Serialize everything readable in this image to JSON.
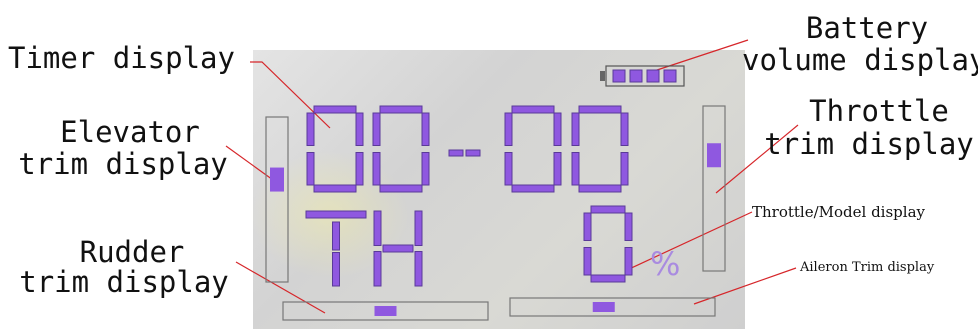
{
  "display": {
    "timer_text": "00-00",
    "mode_text": "TH",
    "throttle_value": "0",
    "percent_sign": "%",
    "elevator_trim": 0.35,
    "throttle_trim": 0.25,
    "rudder_trim": 0.5,
    "aileron_trim": 0.45,
    "battery_bars": 4,
    "segment_color": "#8f58e0",
    "segment_edge_color": "#5a3a99"
  },
  "labels": {
    "timer": "Timer display",
    "battery_line1": "Battery",
    "battery_line2": "volume display",
    "elevator_line1": "Elevator",
    "elevator_line2": "trim display",
    "throttle_line1": "Throttle",
    "throttle_line2": "trim display",
    "throttle_model": "Throttle/Model display",
    "rudder_line1": "Rudder",
    "rudder_line2": "trim display",
    "aileron": "Aileron Trim display"
  }
}
